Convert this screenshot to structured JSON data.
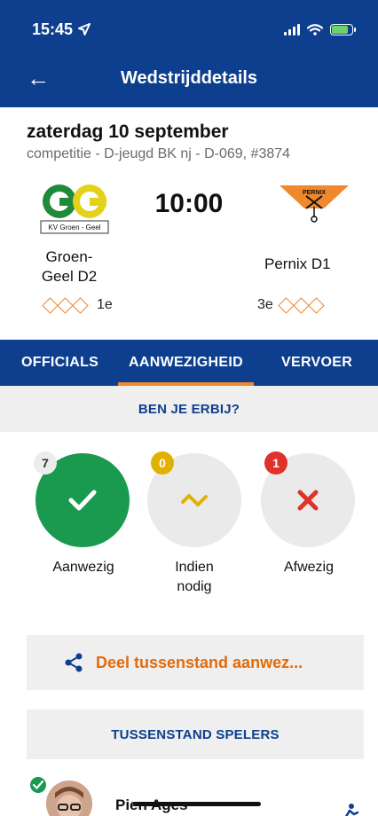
{
  "status_bar": {
    "time": "15:45"
  },
  "nav": {
    "title": "Wedstrijddetails"
  },
  "match": {
    "date": "zaterdag 10 september",
    "competition": "competitie - D-jeugd BK nj - D-069, #3874",
    "kickoff": "10:00",
    "home": {
      "name": "Groen-Geel D2",
      "name_line1": "Groen-",
      "name_line2": "Geel D2",
      "rank": "1e",
      "logo_text": "KV Groen - Geel"
    },
    "away": {
      "name": "Pernix D1",
      "rank": "3e",
      "logo_text": "PERNIX"
    }
  },
  "tabs": [
    {
      "label": "OFFICIALS",
      "active": false
    },
    {
      "label": "AANWEZIGHEID",
      "active": true
    },
    {
      "label": "VERVOER",
      "active": false
    }
  ],
  "attendance": {
    "question": "BEN JE ERBIJ?",
    "options": [
      {
        "label": "Aanwezig",
        "count": "7",
        "icon": "check-icon",
        "badge_color": "#1a9a4f"
      },
      {
        "label_line1": "Indien",
        "label_line2": "nodig",
        "label": "Indien nodig",
        "count": "0",
        "icon": "zigzag-icon",
        "badge_color": "#e0b100"
      },
      {
        "label": "Afwezig",
        "count": "1",
        "icon": "cross-icon",
        "badge_color": "#e0312b"
      }
    ]
  },
  "share": {
    "label": "Deel tussenstand aanwez..."
  },
  "players_section": {
    "title": "TUSSENSTAND SPELERS"
  },
  "players": [
    {
      "name": "Pien Ages"
    }
  ],
  "colors": {
    "brand": "#0e3f8e",
    "accent": "#f0882d",
    "present": "#1a9a4f"
  }
}
